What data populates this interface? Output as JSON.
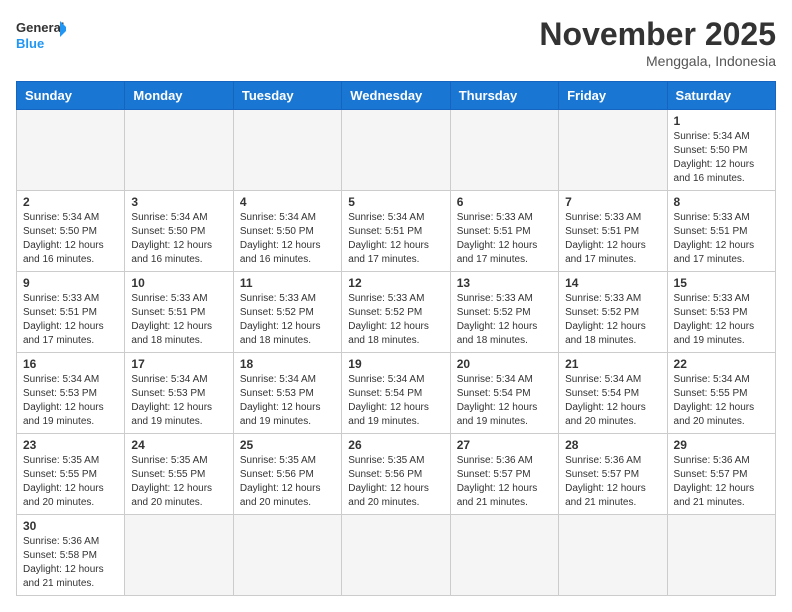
{
  "header": {
    "logo_general": "General",
    "logo_blue": "Blue",
    "month_title": "November 2025",
    "location": "Menggala, Indonesia"
  },
  "days_of_week": [
    "Sunday",
    "Monday",
    "Tuesday",
    "Wednesday",
    "Thursday",
    "Friday",
    "Saturday"
  ],
  "weeks": [
    [
      {
        "day": "",
        "info": ""
      },
      {
        "day": "",
        "info": ""
      },
      {
        "day": "",
        "info": ""
      },
      {
        "day": "",
        "info": ""
      },
      {
        "day": "",
        "info": ""
      },
      {
        "day": "",
        "info": ""
      },
      {
        "day": "1",
        "info": "Sunrise: 5:34 AM\nSunset: 5:50 PM\nDaylight: 12 hours and 16 minutes."
      }
    ],
    [
      {
        "day": "2",
        "info": "Sunrise: 5:34 AM\nSunset: 5:50 PM\nDaylight: 12 hours and 16 minutes."
      },
      {
        "day": "3",
        "info": "Sunrise: 5:34 AM\nSunset: 5:50 PM\nDaylight: 12 hours and 16 minutes."
      },
      {
        "day": "4",
        "info": "Sunrise: 5:34 AM\nSunset: 5:50 PM\nDaylight: 12 hours and 16 minutes."
      },
      {
        "day": "5",
        "info": "Sunrise: 5:34 AM\nSunset: 5:51 PM\nDaylight: 12 hours and 17 minutes."
      },
      {
        "day": "6",
        "info": "Sunrise: 5:33 AM\nSunset: 5:51 PM\nDaylight: 12 hours and 17 minutes."
      },
      {
        "day": "7",
        "info": "Sunrise: 5:33 AM\nSunset: 5:51 PM\nDaylight: 12 hours and 17 minutes."
      },
      {
        "day": "8",
        "info": "Sunrise: 5:33 AM\nSunset: 5:51 PM\nDaylight: 12 hours and 17 minutes."
      }
    ],
    [
      {
        "day": "9",
        "info": "Sunrise: 5:33 AM\nSunset: 5:51 PM\nDaylight: 12 hours and 17 minutes."
      },
      {
        "day": "10",
        "info": "Sunrise: 5:33 AM\nSunset: 5:51 PM\nDaylight: 12 hours and 18 minutes."
      },
      {
        "day": "11",
        "info": "Sunrise: 5:33 AM\nSunset: 5:52 PM\nDaylight: 12 hours and 18 minutes."
      },
      {
        "day": "12",
        "info": "Sunrise: 5:33 AM\nSunset: 5:52 PM\nDaylight: 12 hours and 18 minutes."
      },
      {
        "day": "13",
        "info": "Sunrise: 5:33 AM\nSunset: 5:52 PM\nDaylight: 12 hours and 18 minutes."
      },
      {
        "day": "14",
        "info": "Sunrise: 5:33 AM\nSunset: 5:52 PM\nDaylight: 12 hours and 18 minutes."
      },
      {
        "day": "15",
        "info": "Sunrise: 5:33 AM\nSunset: 5:53 PM\nDaylight: 12 hours and 19 minutes."
      }
    ],
    [
      {
        "day": "16",
        "info": "Sunrise: 5:34 AM\nSunset: 5:53 PM\nDaylight: 12 hours and 19 minutes."
      },
      {
        "day": "17",
        "info": "Sunrise: 5:34 AM\nSunset: 5:53 PM\nDaylight: 12 hours and 19 minutes."
      },
      {
        "day": "18",
        "info": "Sunrise: 5:34 AM\nSunset: 5:53 PM\nDaylight: 12 hours and 19 minutes."
      },
      {
        "day": "19",
        "info": "Sunrise: 5:34 AM\nSunset: 5:54 PM\nDaylight: 12 hours and 19 minutes."
      },
      {
        "day": "20",
        "info": "Sunrise: 5:34 AM\nSunset: 5:54 PM\nDaylight: 12 hours and 19 minutes."
      },
      {
        "day": "21",
        "info": "Sunrise: 5:34 AM\nSunset: 5:54 PM\nDaylight: 12 hours and 20 minutes."
      },
      {
        "day": "22",
        "info": "Sunrise: 5:34 AM\nSunset: 5:55 PM\nDaylight: 12 hours and 20 minutes."
      }
    ],
    [
      {
        "day": "23",
        "info": "Sunrise: 5:35 AM\nSunset: 5:55 PM\nDaylight: 12 hours and 20 minutes."
      },
      {
        "day": "24",
        "info": "Sunrise: 5:35 AM\nSunset: 5:55 PM\nDaylight: 12 hours and 20 minutes."
      },
      {
        "day": "25",
        "info": "Sunrise: 5:35 AM\nSunset: 5:56 PM\nDaylight: 12 hours and 20 minutes."
      },
      {
        "day": "26",
        "info": "Sunrise: 5:35 AM\nSunset: 5:56 PM\nDaylight: 12 hours and 20 minutes."
      },
      {
        "day": "27",
        "info": "Sunrise: 5:36 AM\nSunset: 5:57 PM\nDaylight: 12 hours and 21 minutes."
      },
      {
        "day": "28",
        "info": "Sunrise: 5:36 AM\nSunset: 5:57 PM\nDaylight: 12 hours and 21 minutes."
      },
      {
        "day": "29",
        "info": "Sunrise: 5:36 AM\nSunset: 5:57 PM\nDaylight: 12 hours and 21 minutes."
      }
    ],
    [
      {
        "day": "30",
        "info": "Sunrise: 5:36 AM\nSunset: 5:58 PM\nDaylight: 12 hours and 21 minutes."
      },
      {
        "day": "",
        "info": ""
      },
      {
        "day": "",
        "info": ""
      },
      {
        "day": "",
        "info": ""
      },
      {
        "day": "",
        "info": ""
      },
      {
        "day": "",
        "info": ""
      },
      {
        "day": "",
        "info": ""
      }
    ]
  ]
}
